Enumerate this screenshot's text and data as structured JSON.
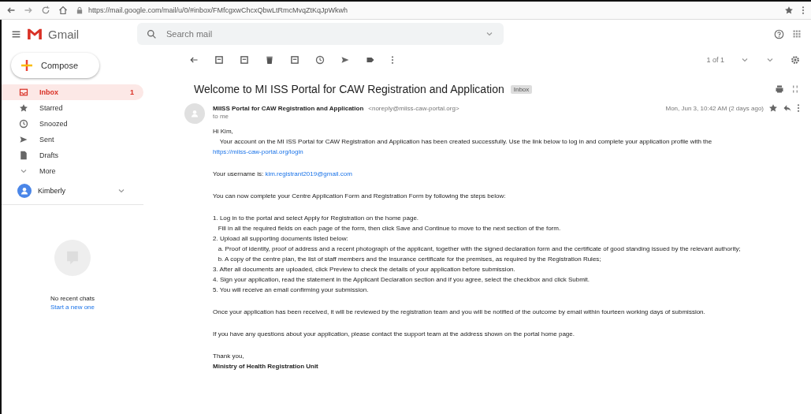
{
  "browser": {
    "url": "https://mail.google.com/mail/u/0/#inbox/FMfcgxwChcxQbwLtRmcMvqZtKqJpWkwh"
  },
  "header": {
    "app_name": "Gmail",
    "search": {
      "placeholder": "Search mail"
    }
  },
  "sidebar": {
    "compose": "Compose",
    "items": [
      {
        "label": "Inbox",
        "count": "1",
        "selected": true,
        "kind": "inbox"
      },
      {
        "label": "Starred",
        "selected": false,
        "kind": "star"
      },
      {
        "label": "Snoozed",
        "selected": false,
        "kind": "clock"
      },
      {
        "label": "Sent",
        "selected": false,
        "kind": "send"
      },
      {
        "label": "Drafts",
        "selected": false,
        "kind": "file"
      },
      {
        "label": "More",
        "selected": false,
        "kind": "more"
      }
    ],
    "account": {
      "name": "Kimberly"
    },
    "chats": {
      "empty_text": "No recent chats",
      "link": "Start a new one"
    }
  },
  "toolbar": {
    "pager": "1 of 1"
  },
  "message": {
    "subject": "Welcome to MI ISS Portal for CAW Registration and Application",
    "label": "Inbox",
    "sender": "MIISS Portal for CAW Registration and Application",
    "sender_address": "<noreply@miiss-caw-portal.org>",
    "date": "Mon, Jun 3, 10:42 AM (2 days ago)",
    "to": "to me",
    "paragraphs": [
      {
        "lines": [
          {
            "text": "Hi Kim,"
          },
          {
            "text": "    Your account on the MI ISS Portal for CAW Registration and Application has been created successfully. Use the link below to log in and complete your application profile with the"
          },
          {
            "link": "https://miiss-caw-portal.org/login"
          }
        ]
      },
      {
        "lines": [
          {
            "text": "Your username is: ",
            "link": "kim.registrant2019@gmail.com"
          }
        ]
      },
      {
        "lines": [
          {
            "text": "You can now complete your Centre Application Form and Registration Form by following the steps below:"
          }
        ]
      },
      {
        "lines": [
          {
            "text": "1. Log in to the portal and select Apply for Registration on the home page."
          },
          {
            "text": "   Fill in all the required fields on each page of the form, then click Save and Continue to move to the next section of the form."
          },
          {
            "text": "2. Upload all supporting documents listed below:"
          },
          {
            "text": "   a. Proof of identity, proof of address and a recent photograph of the applicant, together with the signed declaration form and the certificate of good standing issued by the relevant authority;"
          },
          {
            "text": "   b. A copy of the centre plan, the list of staff members and the insurance certificate for the premises, as required by the Registration Rules;"
          },
          {
            "text": "3. After all documents are uploaded, click Preview to check the details of your application before submission."
          },
          {
            "text": "4. Sign your application, read the statement in the Applicant Declaration section and if you agree, select the checkbox and click Submit."
          },
          {
            "text": "5. You will receive an email confirming your submission."
          }
        ]
      },
      {
        "lines": [
          {
            "text": "Once your application has been received, it will be reviewed by the registration team and you will be notified of the outcome by email within fourteen working days of submission."
          }
        ]
      },
      {
        "lines": [
          {
            "text": "If you have any questions about your application, please contact the support team at the address shown on the portal home page."
          }
        ]
      },
      {
        "lines": [
          {
            "text": "Thank you,"
          },
          {
            "text": "Ministry of Health Registration Unit",
            "bold": true
          }
        ]
      }
    ]
  }
}
